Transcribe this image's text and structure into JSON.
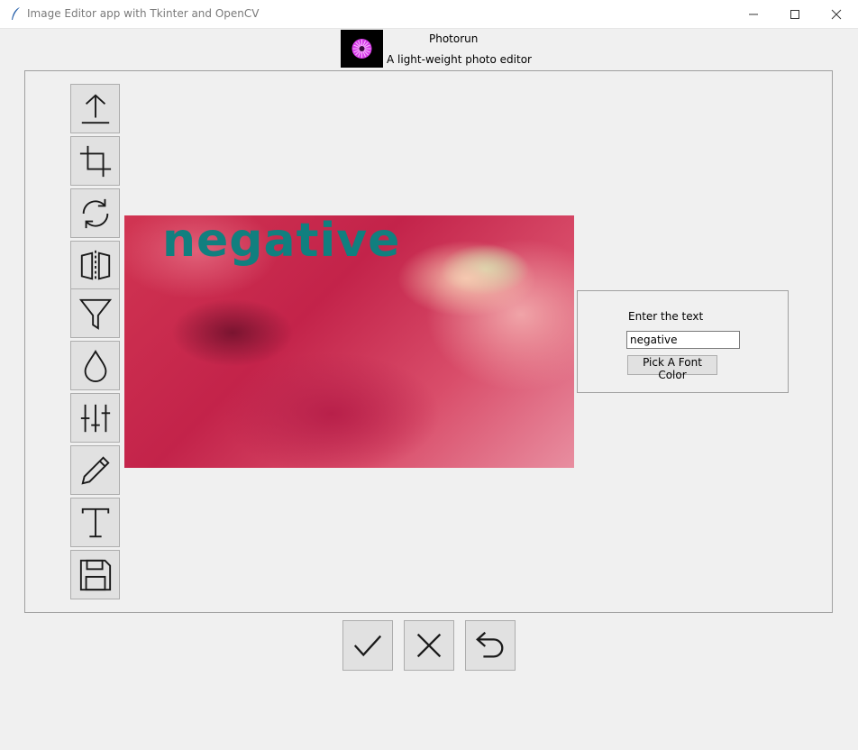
{
  "window": {
    "title": "Image Editor app with Tkinter and OpenCV",
    "controls": [
      "minimize-icon",
      "maximize-icon",
      "close-icon"
    ]
  },
  "header": {
    "app_name": "Photorun",
    "subtitle": "A light-weight photo editor",
    "logo_icon": "flower-logo-icon",
    "logo_color": "#e040fb"
  },
  "toolbar": {
    "tools": [
      {
        "name": "upload",
        "icon": "upload-icon"
      },
      {
        "name": "crop",
        "icon": "crop-icon"
      },
      {
        "name": "rotate",
        "icon": "rotate-icon"
      },
      {
        "name": "flip",
        "icon": "flip-icon"
      },
      {
        "name": "filter",
        "icon": "filter-icon"
      },
      {
        "name": "blur",
        "icon": "drop-icon"
      },
      {
        "name": "adjust",
        "icon": "sliders-icon"
      },
      {
        "name": "draw",
        "icon": "pencil-icon"
      },
      {
        "name": "text",
        "icon": "text-icon"
      },
      {
        "name": "save",
        "icon": "save-icon"
      }
    ]
  },
  "canvas": {
    "overlay_text": "negative",
    "overlay_color": "#117f7f"
  },
  "text_panel": {
    "label": "Enter the text",
    "input_value": "negative",
    "color_button": "Pick A Font Color"
  },
  "actions": [
    {
      "name": "apply",
      "icon": "check-icon"
    },
    {
      "name": "cancel",
      "icon": "x-icon"
    },
    {
      "name": "undo",
      "icon": "undo-icon"
    }
  ]
}
